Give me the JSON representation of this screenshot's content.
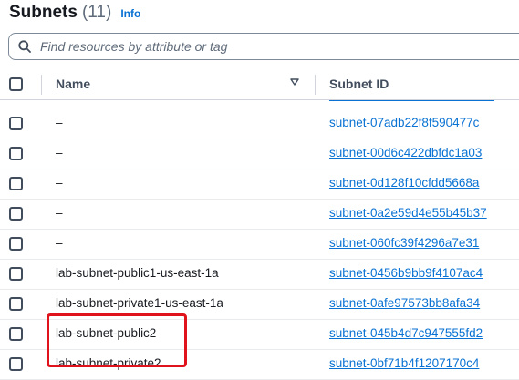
{
  "header": {
    "title": "Subnets",
    "count": "(11)",
    "info_label": "Info"
  },
  "search": {
    "placeholder": "Find resources by attribute or tag"
  },
  "table": {
    "columns": {
      "name": "Name",
      "subnet_id": "Subnet ID"
    },
    "rows": [
      {
        "name": "–",
        "subnet_id": "subnet-07adb22f8f590477c"
      },
      {
        "name": "–",
        "subnet_id": "subnet-00d6c422dbfdc1a03"
      },
      {
        "name": "–",
        "subnet_id": "subnet-0d128f10cfdd5668a"
      },
      {
        "name": "–",
        "subnet_id": "subnet-0a2e59d4e55b45b37"
      },
      {
        "name": "–",
        "subnet_id": "subnet-060fc39f4296a7e31"
      },
      {
        "name": "lab-subnet-public1-us-east-1a",
        "subnet_id": "subnet-0456b9bb9f4107ac4"
      },
      {
        "name": "lab-subnet-private1-us-east-1a",
        "subnet_id": "subnet-0afe97573bb8afa34"
      },
      {
        "name": "lab-subnet-public2",
        "subnet_id": "subnet-045b4d7c947555fd2"
      },
      {
        "name": "lab-subnet-private2",
        "subnet_id": "subnet-0bf71b4f1207170c4"
      }
    ]
  },
  "colors": {
    "link": "#0972d3",
    "highlight": "#e0131d"
  }
}
